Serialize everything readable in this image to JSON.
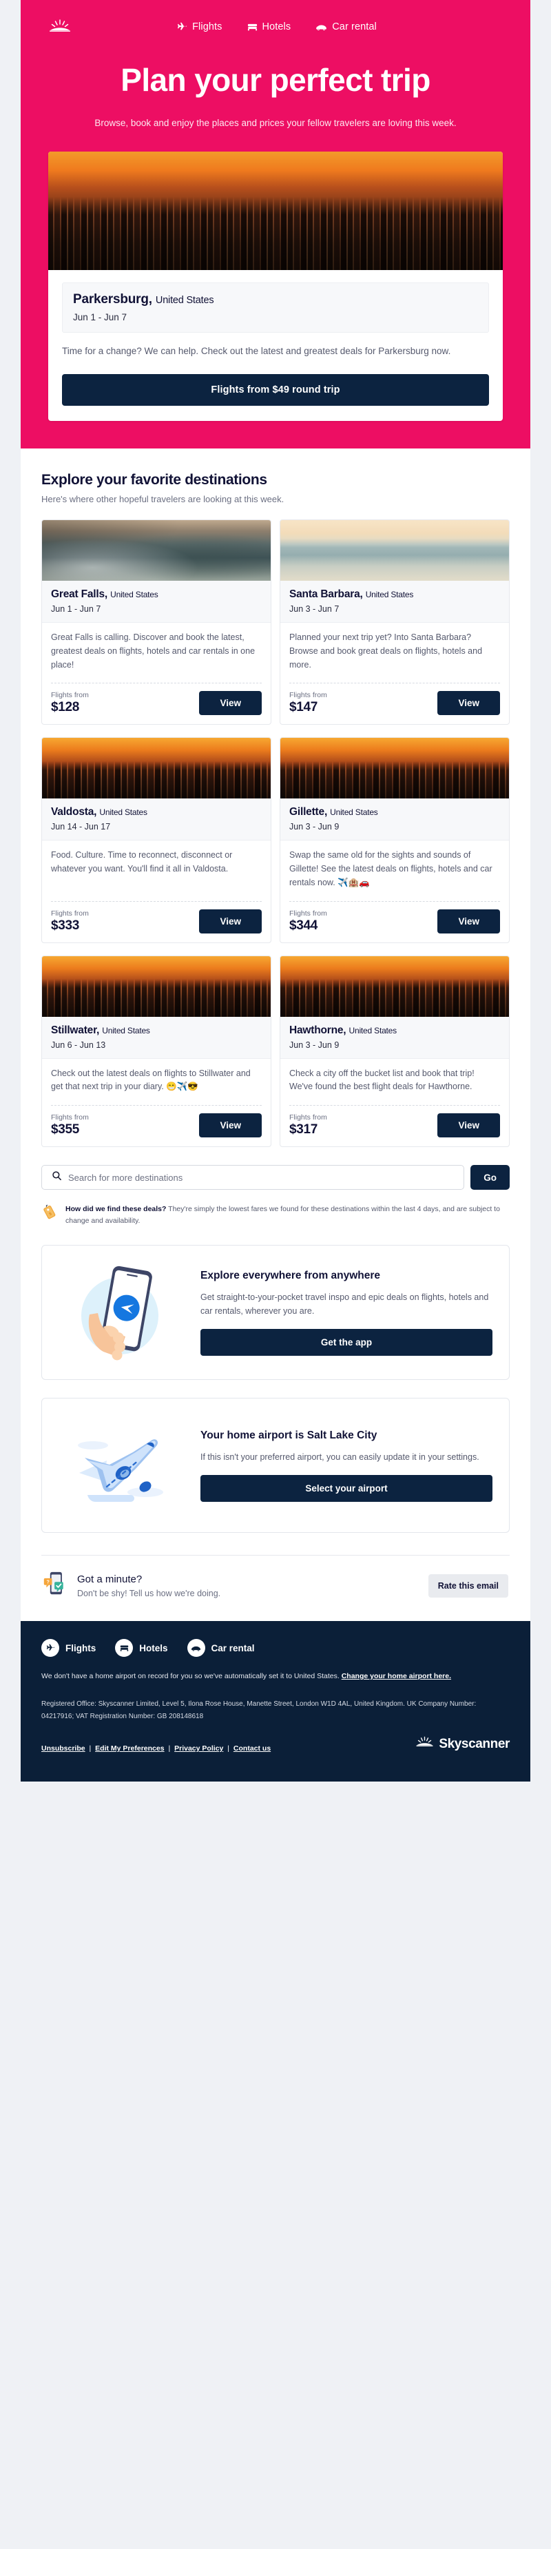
{
  "brand": {
    "name": "Skyscanner",
    "accent": "#ed0e63",
    "dark": "#0c2340"
  },
  "header": {
    "logo_name": "skyscanner-sun-logo",
    "nav": [
      {
        "label": "Flights",
        "icon": "plane-icon"
      },
      {
        "label": "Hotels",
        "icon": "bed-icon"
      },
      {
        "label": "Car rental",
        "icon": "car-icon"
      }
    ]
  },
  "hero": {
    "title": "Plan your perfect trip",
    "subtitle": "Browse, book and enjoy the places and prices your fellow travelers are loving this week."
  },
  "featured": {
    "photo_alt": "new-york-skyline-sunset-photo",
    "city": "Parkersburg,",
    "country": "United States",
    "dates": "Jun 1 - Jun 7",
    "blurb": "Time for a change? We can help. Check out the latest and greatest deals for Parkersburg now.",
    "cta": "Flights from $49 round trip"
  },
  "explore": {
    "title": "Explore your favorite destinations",
    "subtitle": "Here's where other hopeful travelers are looking at this week.",
    "price_label": "Flights from",
    "view_label": "View",
    "cards": [
      {
        "photo": "ph-coast",
        "photo_alt": "rocky-coastline-photo",
        "city": "Great Falls,",
        "country": "United States",
        "dates": "Jun 1 - Jun 7",
        "desc": "Great Falls is calling. Discover and book the latest, greatest deals on flights, hotels and car rentals in one place!",
        "price": "$128"
      },
      {
        "photo": "ph-beach",
        "photo_alt": "beach-shoreline-photo",
        "city": "Santa Barbara,",
        "country": "United States",
        "dates": "Jun 3 - Jun 7",
        "desc": "Planned your next trip yet? Into Santa Barbara? Browse and book great deals on flights, hotels and more.",
        "price": "$147"
      },
      {
        "photo": "ph-city",
        "photo_alt": "city-skyline-sunset-photo",
        "city": "Valdosta,",
        "country": "United States",
        "dates": "Jun 14 - Jun 17",
        "desc": "Food. Culture. Time to reconnect, disconnect or whatever you want. You'll find it all in Valdosta.",
        "price": "$333"
      },
      {
        "photo": "ph-city",
        "photo_alt": "city-skyline-sunset-photo",
        "city": "Gillette,",
        "country": "United States",
        "dates": "Jun 3 - Jun 9",
        "desc": "Swap the same old for the sights and sounds of Gillette! See the latest deals on flights, hotels and car rentals now. ✈️🏨🚗",
        "price": "$344"
      },
      {
        "photo": "ph-city",
        "photo_alt": "city-skyline-sunset-photo",
        "city": "Stillwater,",
        "country": "United States",
        "dates": "Jun 6 - Jun 13",
        "desc": "Check out the latest deals on flights to Stillwater and get that next trip in your diary. 😁✈️😎",
        "price": "$355"
      },
      {
        "photo": "ph-city",
        "photo_alt": "city-skyline-sunset-photo",
        "city": "Hawthorne,",
        "country": "United States",
        "dates": "Jun 3 - Jun 9",
        "desc": "Check a city off the bucket list and book that trip! We've found the best flight deals for Hawthorne.",
        "price": "$317"
      }
    ]
  },
  "search": {
    "placeholder": "Search for more destinations",
    "value": "",
    "go_label": "Go",
    "icon": "search-icon"
  },
  "disclaimer": {
    "icon": "price-tag-icon",
    "bold": "How did we find these deals?",
    "text": " They're simply the lowest fares we found for these destinations within the last 4 days, and are subject to change and availability."
  },
  "app_promo": {
    "art": "hand-holding-phone-illustration",
    "title": "Explore everywhere from anywhere",
    "text": "Get straight-to-your-pocket travel inspo and epic deals on flights, hotels and car rentals, wherever you are.",
    "cta": "Get the app"
  },
  "airport_promo": {
    "art": "airplane-illustration",
    "title": "Your home airport is Salt Lake City",
    "text": "If this isn't your preferred airport, you can easily update it in your settings.",
    "cta": "Select your airport"
  },
  "rate": {
    "art": "phone-feedback-illustration",
    "title": "Got a minute?",
    "subtitle": "Don't be shy! Tell us how we're doing.",
    "cta": "Rate this email"
  },
  "footer": {
    "nav": [
      {
        "label": "Flights",
        "icon": "plane-icon"
      },
      {
        "label": "Hotels",
        "icon": "bed-icon"
      },
      {
        "label": "Car rental",
        "icon": "car-icon"
      }
    ],
    "note_text": "We don't have a home airport on record for you so we've automatically set it to United States. ",
    "note_link": "Change your home airport here.",
    "legal": "Registered Office: Skyscanner Limited, Level 5, Ilona Rose House, Manette Street, London W1D 4AL, United Kingdom. UK Company Number: 04217916; VAT Registration Number: GB 208148618",
    "links": [
      "Unsubscribe",
      "Edit My Preferences",
      "Privacy Policy",
      "Contact us"
    ],
    "brand_name": "Skyscanner"
  }
}
